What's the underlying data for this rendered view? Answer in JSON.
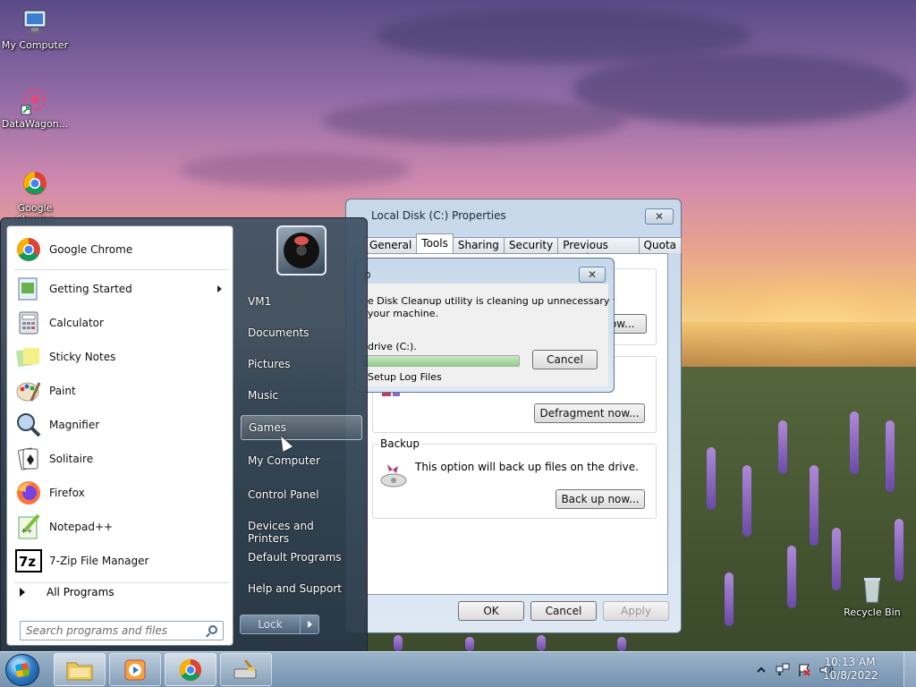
{
  "desktop": {
    "icons": [
      {
        "label": "My Computer"
      },
      {
        "label": "DataWagon..."
      },
      {
        "label": "Google Chrome"
      },
      {
        "label": "Recycle Bin"
      }
    ]
  },
  "start_menu": {
    "programs": [
      {
        "label": "Google Chrome",
        "icon": "chrome-icon"
      },
      {
        "label": "Getting Started",
        "icon": "getting-started-icon",
        "has_submenu": true
      },
      {
        "label": "Calculator",
        "icon": "calculator-icon"
      },
      {
        "label": "Sticky Notes",
        "icon": "sticky-notes-icon"
      },
      {
        "label": "Paint",
        "icon": "paint-icon"
      },
      {
        "label": "Magnifier",
        "icon": "magnifier-icon"
      },
      {
        "label": "Solitaire",
        "icon": "solitaire-icon"
      },
      {
        "label": "Firefox",
        "icon": "firefox-icon"
      },
      {
        "label": "Notepad++",
        "icon": "notepadpp-icon"
      },
      {
        "label": "7-Zip File Manager",
        "icon": "7zip-icon"
      }
    ],
    "all_programs": "All Programs",
    "search_placeholder": "Search programs and files",
    "right_items": [
      {
        "label": "VM1"
      },
      {
        "label": "Documents"
      },
      {
        "label": "Pictures"
      },
      {
        "label": "Music"
      },
      {
        "label": "Games",
        "highlighted": true
      },
      {
        "label": "My Computer"
      },
      {
        "label": "Control Panel"
      },
      {
        "label": "Devices and Printers"
      },
      {
        "label": "Default Programs"
      },
      {
        "label": "Help and Support"
      }
    ],
    "lock_label": "Lock"
  },
  "properties_dialog": {
    "title": "Local Disk (C:) Properties",
    "close": "✕",
    "tabs": [
      "General",
      "Tools",
      "Sharing",
      "Security",
      "Previous Versions",
      "Quota"
    ],
    "active_tab": "Tools",
    "check_button": "...ow...",
    "defragment_button": "Defragment now...",
    "backup_group_title": "Backup",
    "backup_text": "This option will back up files on the drive.",
    "backup_button": "Back up now...",
    "ok": "OK",
    "cancel": "Cancel",
    "apply": "Apply"
  },
  "cleanup_dialog": {
    "title": "p",
    "close": "✕",
    "message_line1": "e Disk Cleanup utility is cleaning up unnecessary files",
    "message_line2": "your machine.",
    "drive_label": "drive  (C:).",
    "cancel": "Cancel",
    "current_item": "Setup Log Files",
    "progress": 1.0
  },
  "taskbar": {
    "time": "10:13 AM",
    "date": "10/8/2022"
  },
  "colors": {
    "accent": "#2f7fc8",
    "taskbar": "#8aa6c2",
    "start_menu": "#3c5064"
  }
}
